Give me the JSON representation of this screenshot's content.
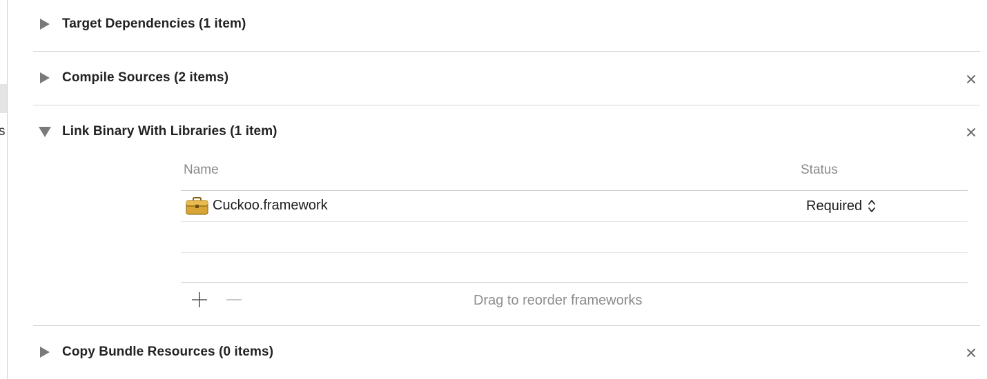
{
  "sidebar": {
    "clipped_text": "s"
  },
  "phases": [
    {
      "title": "Target Dependencies (1 item)",
      "state": "collapsed",
      "removable": false
    },
    {
      "title": "Compile Sources (2 items)",
      "state": "collapsed",
      "removable": true
    },
    {
      "title": "Link Binary With Libraries (1 item)",
      "state": "expanded",
      "removable": true
    },
    {
      "title": "Copy Bundle Resources (0 items)",
      "state": "collapsed",
      "removable": true
    }
  ],
  "libraries": {
    "columns": {
      "name": "Name",
      "status": "Status"
    },
    "rows": [
      {
        "name": "Cuckoo.framework",
        "status": "Required",
        "icon": "toolbox-framework-icon"
      }
    ],
    "footer_hint": "Drag to reorder frameworks",
    "add_icon": "plus-icon",
    "remove_icon": "minus-icon"
  },
  "colors": {
    "disclosure": "#7a7a7a",
    "framework_icon": "#d9a536",
    "muted_text": "#8a8a8a"
  }
}
